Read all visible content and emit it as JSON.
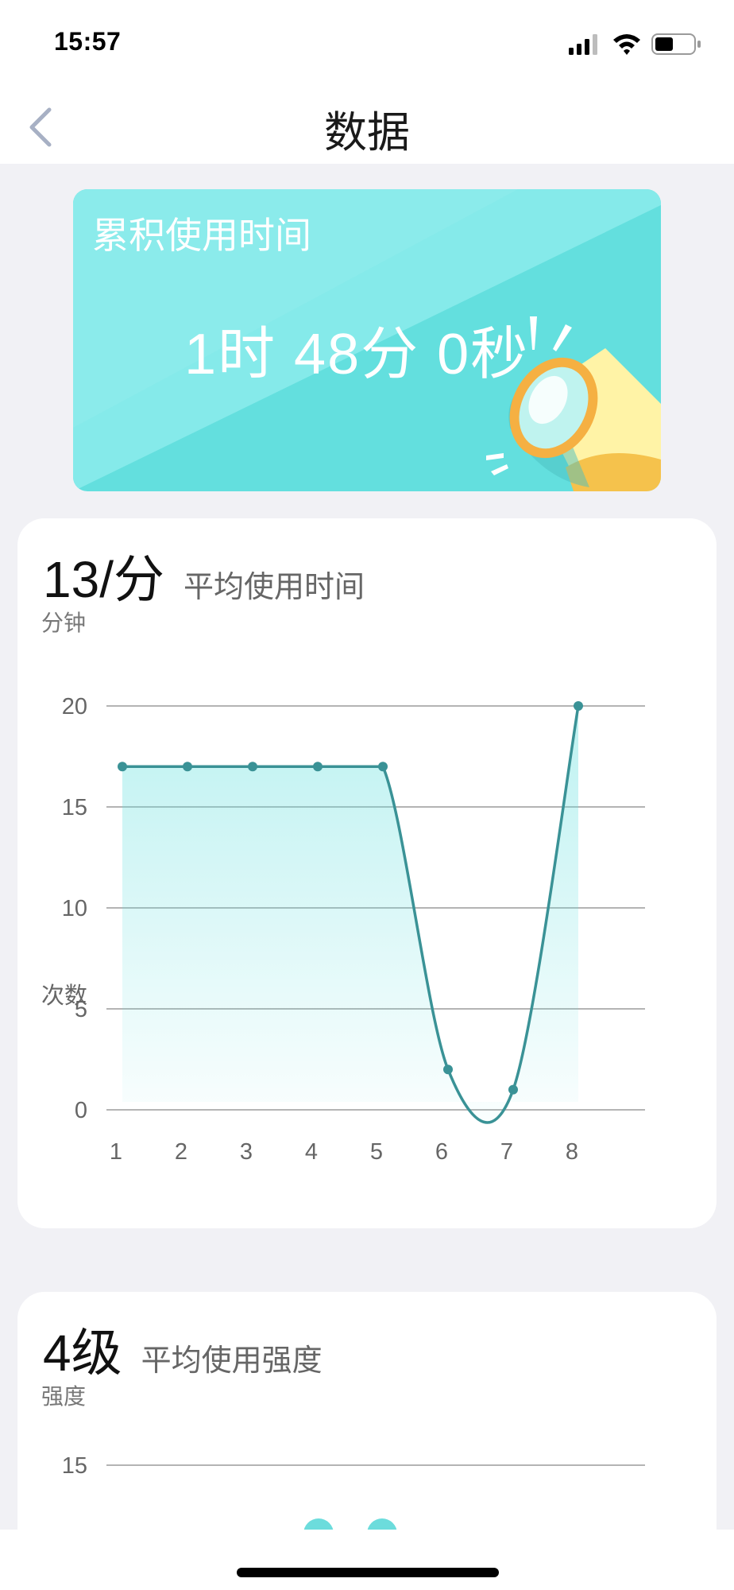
{
  "status_bar": {
    "time": "15:57",
    "icons": [
      "signal-icon",
      "wifi-icon",
      "battery-icon"
    ]
  },
  "nav": {
    "title": "数据",
    "back_icon": "chevron-left-icon"
  },
  "banner": {
    "label": "累积使用时间",
    "value": "1时 48分 0秒",
    "illustration": "megaphone-icon",
    "color": "#63dfde"
  },
  "duration_card": {
    "value": "13/分",
    "caption": "平均使用时间",
    "y_unit": "分钟",
    "x_unit": "次数"
  },
  "intensity_card": {
    "value": "4级",
    "caption": "平均使用强度",
    "y_unit": "强度"
  },
  "colors": {
    "accent": "#3a9296",
    "banner": "#63dfde",
    "background": "#f1f1f5"
  },
  "chart_data": [
    {
      "type": "area",
      "x": [
        "1",
        "2",
        "3",
        "4",
        "5",
        "6",
        "7",
        "8"
      ],
      "values": [
        17,
        17,
        17,
        17,
        17,
        2,
        1,
        20
      ],
      "yticks": [
        "20",
        "15",
        "10",
        "5",
        "0"
      ],
      "ylabel": "分钟",
      "xlabel": "次数",
      "ylim": [
        0,
        20
      ],
      "grid": true,
      "line_color": "#3a9296",
      "fill_color": "#63dfde"
    },
    {
      "type": "line",
      "yticks": [
        "15"
      ],
      "ylabel": "强度",
      "grid": true,
      "marker_color": "#6cdcdc"
    }
  ]
}
